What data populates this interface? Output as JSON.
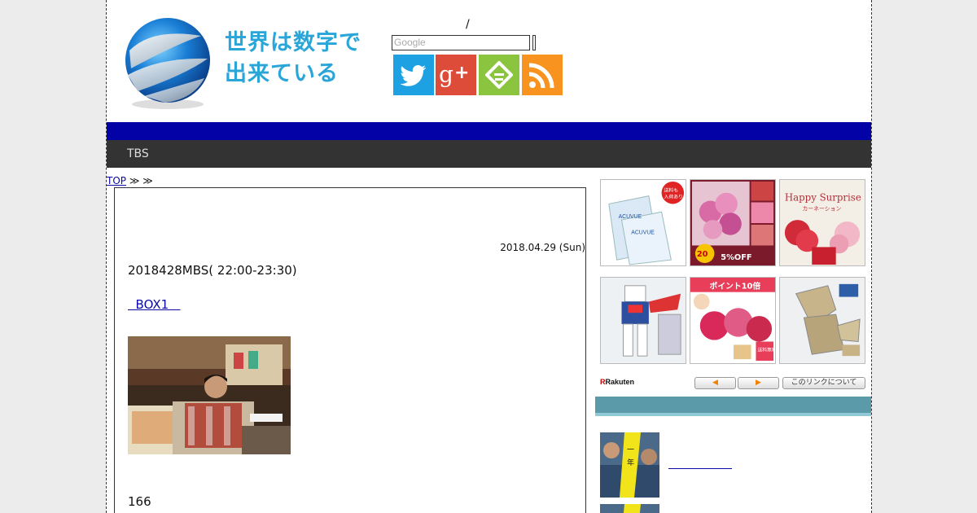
{
  "header": {
    "site_title_line1": "世界は数字で",
    "site_title_line2": "出来ている",
    "slash": "/",
    "search_placeholder": "Google"
  },
  "nav": {
    "item_tbs": "TBS"
  },
  "breadcrumb": {
    "top": "TOP",
    "sep1": " ≫ ",
    "sep2": " ≫"
  },
  "article": {
    "date": "2018.04.29 (Sun)",
    "title": "2018428MBS( 22:00-23:30)",
    "link_text": "  BOX1   ",
    "count": "166"
  },
  "sidebar": {
    "rakuten_logo_r": "R",
    "rakuten_logo_text": "Rakuten",
    "prev_label": "◀",
    "next_label": "▶",
    "about_label": "このリンクについて",
    "ad_texts": {
      "ad1_badge": "送料も\n入荷あり",
      "ad1_brand": "ACUVUE",
      "ad2_badge": "5%OFF",
      "ad3_title": "Happy Surprise",
      "ad3_sub": "カーネーション",
      "ad5_banner": "ポイント10倍",
      "ad5_badge": "送料無料"
    }
  },
  "colors": {
    "blue_bar": "#0202a6",
    "nav_bar": "#333333",
    "logo_text": "#2aa5d8",
    "twitter": "#1da1e2",
    "google_plus": "#dd4b39",
    "feedly": "#8bc540",
    "rss": "#f7931e",
    "sidebar_header": "#5b9aa8"
  },
  "icons": [
    "globe-logo-icon",
    "twitter-icon",
    "google-plus-icon",
    "feedly-icon",
    "rss-icon"
  ]
}
